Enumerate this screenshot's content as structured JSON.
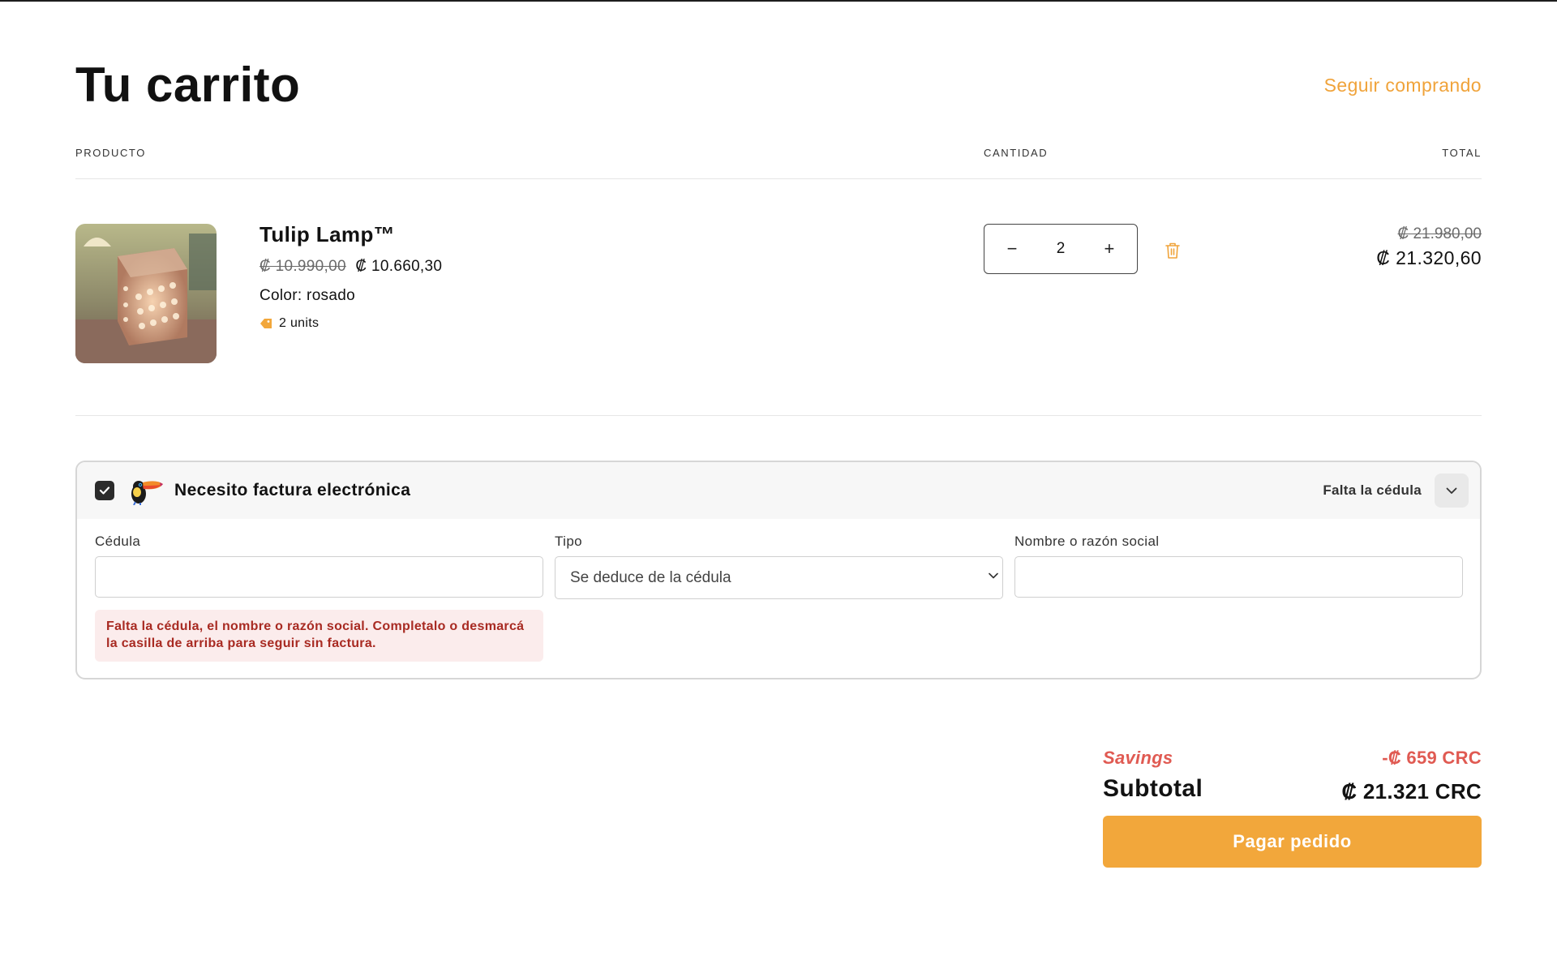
{
  "header": {
    "title": "Tu carrito",
    "continue_label": "Seguir comprando"
  },
  "columns": {
    "product": "PRODUCTO",
    "quantity": "CANTIDAD",
    "total": "TOTAL"
  },
  "item": {
    "name": "Tulip Lamp™",
    "price_original": "₡ 10.990,00",
    "price_sale": "₡ 10.660,30",
    "variant": "Color: rosado",
    "units": "2 units",
    "quantity": "2",
    "decrement": "−",
    "increment": "+",
    "total_original": "₡ 21.980,00",
    "total_sale": "₡ 21.320,60"
  },
  "invoice": {
    "checkbox_checked": true,
    "title": "Necesito factura electrónica",
    "status": "Falta la cédula",
    "cedula_label": "Cédula",
    "cedula_value": "",
    "tipo_label": "Tipo",
    "tipo_selected": "Se deduce de la cédula",
    "nombre_label": "Nombre o razón social",
    "nombre_value": "",
    "error_message": "Falta la cédula, el nombre o razón social. Completalo o desmarcá la casilla de arriba para seguir sin factura."
  },
  "summary": {
    "savings_label": "Savings",
    "savings_value": "-₡ 659 CRC",
    "subtotal_label": "Subtotal",
    "subtotal_value": "₡ 21.321 CRC",
    "checkout_label": "Pagar pedido"
  },
  "colors": {
    "accent": "#f2a73b",
    "link": "#f0a33a",
    "savings": "#e05a52",
    "error_text": "#a82a22",
    "error_bg": "#fbecec"
  },
  "icons": {
    "delete": "trash-icon",
    "tag": "tag-icon",
    "toggle": "chevron-down-icon",
    "brand": "toucan-icon"
  }
}
